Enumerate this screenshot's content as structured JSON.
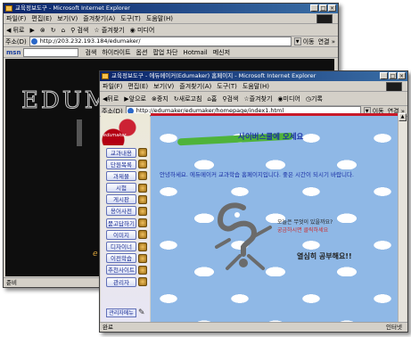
{
  "back_window": {
    "title": "교육정보도구 - Microsoft Internet Explorer",
    "menu": [
      "파일(F)",
      "편집(E)",
      "보기(V)",
      "즐겨찾기(A)",
      "도구(T)",
      "도움말(H)"
    ],
    "toolbar": [
      "뒤로",
      "검색",
      "즐겨찾기",
      "미디어"
    ],
    "address_label": "주소(D)",
    "address_url": "http://203.232.193.184/edumaker/",
    "go_label": "이동",
    "links_label": "연결 »",
    "msn_label": "msn",
    "msn_items": [
      "검색",
      "하이라이트",
      "옵션",
      "팝업 차단",
      "Hotmail",
      "메신저"
    ],
    "logo_text": "EDUMAKER",
    "footer_text": "e",
    "status_text": "준비"
  },
  "front_window": {
    "title": "교육정보도구 - 에듀메이커(Edumaker) 홈페이지 - Microsoft Internet Explorer",
    "menu": [
      "파일(F)",
      "편집(E)",
      "보기(V)",
      "즐겨찾기(A)",
      "도구(T)",
      "도움말(H)"
    ],
    "toolbar": [
      "뒤로",
      "앞으로",
      "중지",
      "새로고침",
      "홈",
      "검색",
      "즐겨찾기",
      "미디어",
      "기록"
    ],
    "address_label": "주소(D)",
    "address_url": "http://edumaker/edumaker/homepage/index1.html",
    "go_label": "이동",
    "links_label": "연결 »",
    "logo_text": "edumaker",
    "nav_items": [
      "교과내용",
      "단원목록",
      "과제물",
      "시험",
      "게시판",
      "용어사전",
      "묻고답하기",
      "이미지",
      "디자이너",
      "이전학습",
      "추천사이트",
      "관리자"
    ],
    "nav_last": "관리자메뉴",
    "heading": "사이버스쿨에 오세요",
    "welcome": "안녕하세요. 에듀메이커 교과학습 홈페이지입니다. 좋은 시간이 되시기 바랍니다.",
    "bubble_question": "오늘은 무엇이 있을까요?",
    "bubble_answer": "궁금하시면 클릭하세요",
    "slogan": "열심히 공부해요!!",
    "status_text": "완료",
    "status_right": "인터넷"
  },
  "colors": {
    "titlebar": "#0a246a",
    "nav_text": "#1d2f94",
    "brush": "#4fb33b",
    "accent_red": "#c81a2a",
    "sky": "#8fb8e6"
  }
}
